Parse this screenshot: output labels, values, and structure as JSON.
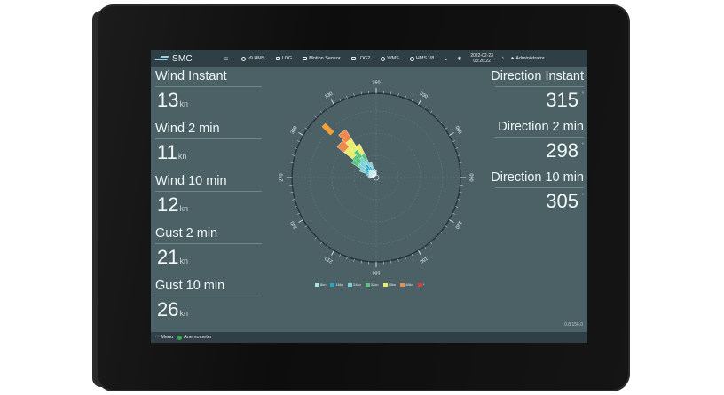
{
  "topbar": {
    "logo": "SMC",
    "tabs": [
      {
        "label": "v9 HMS"
      },
      {
        "label": "LOG"
      },
      {
        "label": "Motion Sensor"
      },
      {
        "label": "LOG2"
      },
      {
        "label": "WMS"
      },
      {
        "label": "HMS V8"
      }
    ],
    "date": "2022-02-23",
    "time": "08:26:22",
    "user": "Administrator"
  },
  "left": [
    {
      "label": "Wind Instant",
      "value": "13",
      "unit": "kn"
    },
    {
      "label": "Wind 2 min",
      "value": "11",
      "unit": "kn"
    },
    {
      "label": "Wind 10 min",
      "value": "12",
      "unit": "kn"
    },
    {
      "label": "Gust 2 min",
      "value": "21",
      "unit": "kn"
    },
    {
      "label": "Gust 10 min",
      "value": "26",
      "unit": "kn"
    }
  ],
  "right": [
    {
      "label": "Direction Instant",
      "value": "315",
      "unit": "°"
    },
    {
      "label": "Direction 2 min",
      "value": "298",
      "unit": "°"
    },
    {
      "label": "Direction 10 min",
      "value": "305",
      "unit": "°"
    }
  ],
  "rose": {
    "ticks": [
      "360",
      "030",
      "060",
      "090",
      "120",
      "150",
      "180",
      "210",
      "240",
      "270",
      "300",
      "330"
    ],
    "colors": [
      "#a7e3e9",
      "#22a7c9",
      "#79cfd6",
      "#58c47e",
      "#e8ee6a",
      "#f08a4b",
      "#e23b3b"
    ]
  },
  "legend": [
    {
      "label": "8kn",
      "color": "#a7e3e9"
    },
    {
      "label": "16kn",
      "color": "#22a7c9"
    },
    {
      "label": "24kn",
      "color": "#79cfd6"
    },
    {
      "label": "32kn",
      "color": "#58c47e"
    },
    {
      "label": "40kn",
      "color": "#e8ee6a"
    },
    {
      "label": "48kn",
      "color": "#f08a4b"
    },
    {
      "label": "*",
      "color": "#e23b3b"
    }
  ],
  "version": "0.8.156.0",
  "status": {
    "menu": "Menu",
    "sensor": "Anemometer"
  }
}
